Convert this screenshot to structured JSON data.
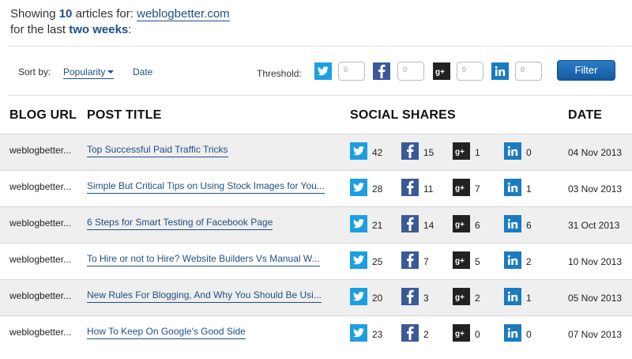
{
  "summary": {
    "showing_prefix": "Showing",
    "count": "10",
    "articles_for": "articles for:",
    "domain": "weblogbetter.com",
    "for_last": "for the last",
    "period": "two weeks",
    "colon": ":"
  },
  "sort": {
    "label": "Sort by:",
    "popularity": "Popularity",
    "date": "Date"
  },
  "threshold": {
    "label": "Threshold:",
    "twitter": "0",
    "facebook": "0",
    "googleplus": "0",
    "linkedin": "0",
    "filter_label": "Filter"
  },
  "headers": {
    "blog_url": "BLOG URL",
    "post_title": "POST TITLE",
    "social_shares": "SOCIAL SHARES",
    "date": "DATE"
  },
  "colors": {
    "twitter": "#1b9fe0",
    "facebook": "#3b5998",
    "googleplus": "#222222",
    "linkedin": "#1a7bbf",
    "accent": "#1e4f86"
  },
  "rows": [
    {
      "blog": "weblogbetter...",
      "title": "Top Successful Paid Traffic Tricks",
      "tw": "42",
      "fb": "15",
      "gp": "1",
      "in": "0",
      "date": "04 Nov 2013"
    },
    {
      "blog": "weblogbetter...",
      "title": "Simple But Critical Tips on Using Stock Images for You...",
      "tw": "28",
      "fb": "11",
      "gp": "7",
      "in": "1",
      "date": "03 Nov 2013"
    },
    {
      "blog": "weblogbetter...",
      "title": "6 Steps for Smart Testing of Facebook Page",
      "tw": "21",
      "fb": "14",
      "gp": "6",
      "in": "6",
      "date": "31 Oct 2013"
    },
    {
      "blog": "weblogbetter...",
      "title": "To Hire or not to Hire? Website Builders Vs Manual W...",
      "tw": "25",
      "fb": "7",
      "gp": "5",
      "in": "2",
      "date": "10 Nov 2013"
    },
    {
      "blog": "weblogbetter...",
      "title": "New Rules For Blogging, And Why You Should Be Usi...",
      "tw": "20",
      "fb": "3",
      "gp": "2",
      "in": "1",
      "date": "05 Nov 2013"
    },
    {
      "blog": "weblogbetter...",
      "title": "How To Keep On Google's Good Side",
      "tw": "23",
      "fb": "2",
      "gp": "0",
      "in": "0",
      "date": "07 Nov 2013"
    }
  ]
}
